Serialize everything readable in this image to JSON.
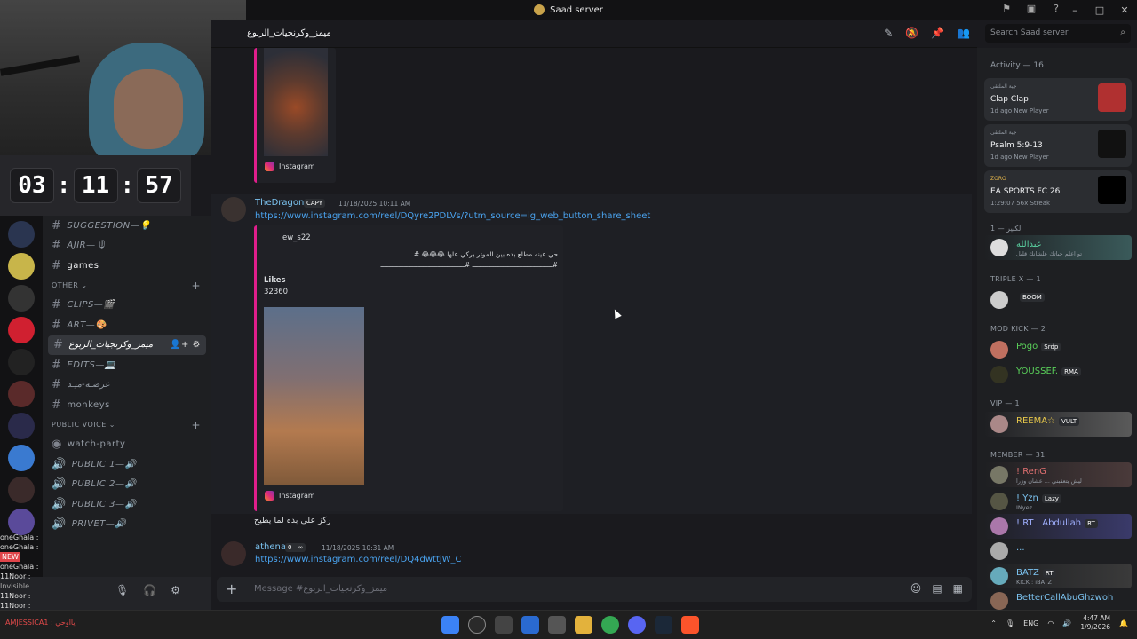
{
  "window": {
    "title": "Saad server"
  },
  "timer": {
    "h": "03",
    "m": "11",
    "s": "57"
  },
  "channel_header": {
    "name": "ميمز_وكرنجيات_الربوع"
  },
  "channels": [
    {
      "name": "SUGGESTION—💡",
      "style": "italic"
    },
    {
      "name": "AJIR—🎙",
      "style": "italic"
    },
    {
      "name": "games",
      "style": "bold"
    },
    {
      "category": "OTHER"
    },
    {
      "name": "CLIPS—🎬",
      "style": "italic"
    },
    {
      "name": "ART—🎨",
      "style": "italic"
    },
    {
      "name": "ميمز_وكرنجيات_الربوع",
      "style": "active"
    },
    {
      "name": "EDITS—💻",
      "style": "italic"
    },
    {
      "name": "عرضـه-ميـد",
      "style": "italic"
    },
    {
      "name": "monkeys",
      "style": "plain"
    },
    {
      "category": "PUBLIC VOICE"
    },
    {
      "name": "watch-party",
      "style": "plain"
    },
    {
      "name": "PUBLIC 1—🔊",
      "style": "italic"
    },
    {
      "name": "PUBLIC 2—🔊",
      "style": "italic"
    },
    {
      "name": "PUBLIC 3—🔊",
      "style": "italic"
    },
    {
      "name": "PRIVET—🔊",
      "style": "italic"
    }
  ],
  "chat_overlay": [
    "oneGhala :",
    "oneGhala :",
    "oneGhala :",
    "11Noor :",
    "11Noor :",
    "11Noor :"
  ],
  "overlay_extra": {
    "new": "NEW",
    "invisible": "Invisible",
    "amj": "AMJESSICA1 : يااوحي"
  },
  "messages": {
    "first_embed_source": "Instagram",
    "m1": {
      "user": "TheDragon",
      "badge": "CAPY",
      "time": "11/18/2025 10:11 AM",
      "link": "https://www.instagram.com/reel/DQyre2PDLVs/?utm_source=ig_web_button_share_sheet",
      "embed_author": "ew_s22",
      "embed_text_1": "حي عينه مطلع بده بين الموتر يركي علها 😂😂😂 #ـــــــــــــــــــــــــــــــــــــــــــــ",
      "embed_text_2": "#ـــــــــــــــــــــــــــــــــــــــــ #ـــــــــــــــــــــــــــــــــــــــــــ",
      "likes_label": "Likes",
      "likes_value": "32360",
      "source": "Instagram",
      "reply": "ركز على بده لما يطيح"
    },
    "m2": {
      "user": "athena",
      "badge": "0—∞",
      "time": "11/18/2025 10:31 AM",
      "link": "https://www.instagram.com/reel/DQ4dwttjW_C"
    }
  },
  "composer": {
    "placeholder": "Message #ميمز_وكرنجيات_الربوع"
  },
  "search": {
    "placeholder": "Search Saad server"
  },
  "activity": {
    "title": "Activity — 16",
    "cards": [
      {
        "sub": "جية الملتقى",
        "title": "Clap Clap",
        "meta": "1d ago  New Player"
      },
      {
        "sub": "جية الملتقى",
        "title": "Psalm 5:9-13",
        "meta": "1d ago  New Player"
      },
      {
        "sub": "ZORO",
        "title": "EA SPORTS FC 26",
        "meta": "1:29:07  56x Streak"
      }
    ]
  },
  "member_sections": [
    {
      "label": "الكبير — 1",
      "members": [
        {
          "name": "عبدالله",
          "status": "تو اعلم حياتك علشانك قليل"
        }
      ]
    },
    {
      "label": "TRIPLE X — 1",
      "members": [
        {
          "name": "BOOM",
          "status": ""
        }
      ]
    },
    {
      "label": "MOD KICK — 2",
      "members": [
        {
          "name": "Pogo",
          "tag": "Srdp"
        },
        {
          "name": "YOUSSEF.",
          "tag": "RMA"
        }
      ]
    },
    {
      "label": "VIP — 1",
      "members": [
        {
          "name": "REEMA☆",
          "tag": "VULT"
        }
      ]
    },
    {
      "label": "MEMBER — 31",
      "members": [
        {
          "name": "! RenG",
          "status": "ليش يتعقبني ... عشان وزرا"
        },
        {
          "name": "! Yzn",
          "tag": "Lazy",
          "status": "INyez"
        },
        {
          "name": "! RT | Abdullah",
          "tag": "RT"
        },
        {
          "name": "...",
          "status": ""
        },
        {
          "name": "BATZ",
          "tag": "RT",
          "status": "KICK : iBATZ"
        },
        {
          "name": "BetterCallAbuGhzwoh",
          "status": ""
        }
      ]
    }
  ],
  "taskbar": {
    "lang": "ENG",
    "time": "4:47 AM",
    "date": "1/9/2026"
  },
  "colors": {
    "accent": "#e01e8c",
    "link": "#4aa3ef",
    "bg": "#1a1a1e"
  }
}
